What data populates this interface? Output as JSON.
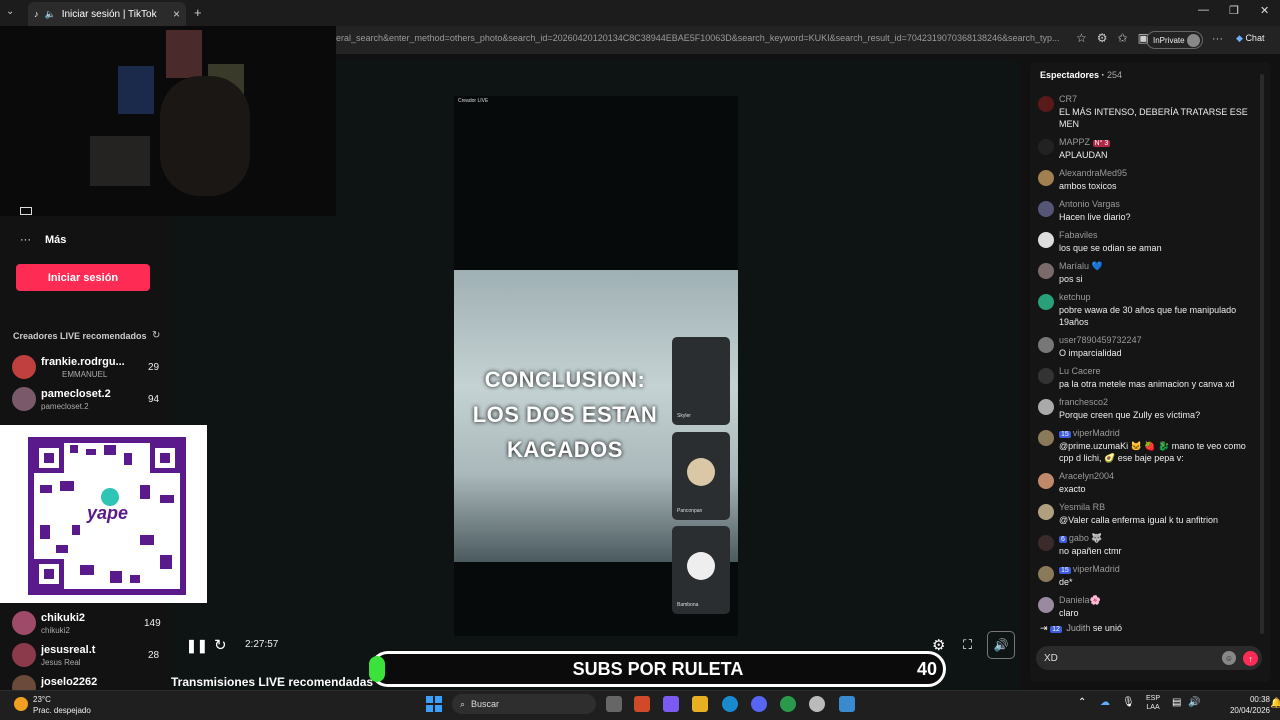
{
  "browser": {
    "tab_title": "Iniciar sesión | TikTok",
    "new_tab_icon": "plus",
    "url_text": "eral_search&enter_method=others_photo&search_id=20260420120134C8C38944EBAE5F10063D&search_keyword=KUKI&search_result_id=7042319070368138246&search_typ...",
    "inprivate_label": "InPrivate",
    "chat_label": "Chat",
    "minimize": "—",
    "maximize": "❐",
    "close": "✕"
  },
  "sidebar": {
    "more_label": "Más",
    "login_button": "Iniciar sesión",
    "recommended_title": "Creadores LIVE recomendados",
    "creators": [
      {
        "name": "frankie.rodrgu...",
        "sub": "EMMANUEL",
        "count": "29"
      },
      {
        "name": "pamecloset.2",
        "sub": "pamecloset.2",
        "count": "94"
      },
      {
        "name": "chikuki2",
        "sub": "chikuki2",
        "count": "149"
      },
      {
        "name": "jesusreal.t",
        "sub": "Jesus Real",
        "count": "28"
      },
      {
        "name": "joselo2262",
        "sub": "",
        "count": ""
      }
    ],
    "qr_label": "yape"
  },
  "video": {
    "creator_label": "Creador LIVE",
    "overlay_text": [
      "CONCLUSION:",
      "LOS DOS ESTAN",
      "KAGADOS"
    ],
    "guests": [
      {
        "name": "Skyler"
      },
      {
        "name": "Panconpan"
      },
      {
        "name": "Bambona"
      }
    ],
    "timecode": "2:27:57",
    "subs_label": "SUBS POR RULETA",
    "subs_count": "40",
    "recommended_title": "Transmisiones LIVE recomendadas"
  },
  "chat": {
    "header": "Espectadores",
    "viewers": "254",
    "messages": [
      {
        "user": "CR7",
        "text": "EL MÁS INTENSO, DEBERÍA TRATARSE ESE MEN",
        "badge": ""
      },
      {
        "user": "MAPPZ",
        "text": "APLAUDAN",
        "badge": "N° 3"
      },
      {
        "user": "AlexandraMed95",
        "text": "ambos toxicos",
        "badge": ""
      },
      {
        "user": "Antonio Vargas",
        "text": "Hacen live diario?",
        "badge": ""
      },
      {
        "user": "Fabaviles",
        "text": "los que se odian se aman",
        "badge": ""
      },
      {
        "user": "Maríalu 💙",
        "text": "pos si",
        "badge": ""
      },
      {
        "user": "ketchup",
        "text": "pobre wawa de 30 años que fue manipulado 19años",
        "badge": ""
      },
      {
        "user": "user7890459732247",
        "text": "O imparcialidad",
        "badge": ""
      },
      {
        "user": "Lu Cacere",
        "text": "pa la otra metele mas animacion y canva xd",
        "badge": ""
      },
      {
        "user": "franchesco2",
        "text": "Porque creen que Zully es víctima?",
        "badge": ""
      },
      {
        "user": "viperMadrid",
        "text": "@prime.uzumaKi 🐱 🍓 🐉 mano te veo como cpp d lichi, 🥑 ese baje pepa v:",
        "badge": "15"
      },
      {
        "user": "Aracelyn2004",
        "text": "exacto",
        "badge": ""
      },
      {
        "user": "Yesmila RB",
        "text": "@Valer calla enferma igual k tu anfitrion",
        "badge": ""
      },
      {
        "user": "gabo 🐺",
        "text": "no apañen ctmr",
        "badge": "6"
      },
      {
        "user": "viperMadrid",
        "text": "de*",
        "badge": "15"
      },
      {
        "user": "Daniela🌸",
        "text": "claro",
        "badge": ""
      }
    ],
    "joined": {
      "badge": "12",
      "user": "Judith",
      "text": "se unió"
    },
    "input_value": "XD"
  },
  "taskbar": {
    "temperature": "23°C",
    "weather": "Prac. despejado",
    "search_label": "Buscar",
    "lang_1": "ESP",
    "lang_2": "LAA",
    "time": "00:38",
    "date": "20/04/2026"
  }
}
